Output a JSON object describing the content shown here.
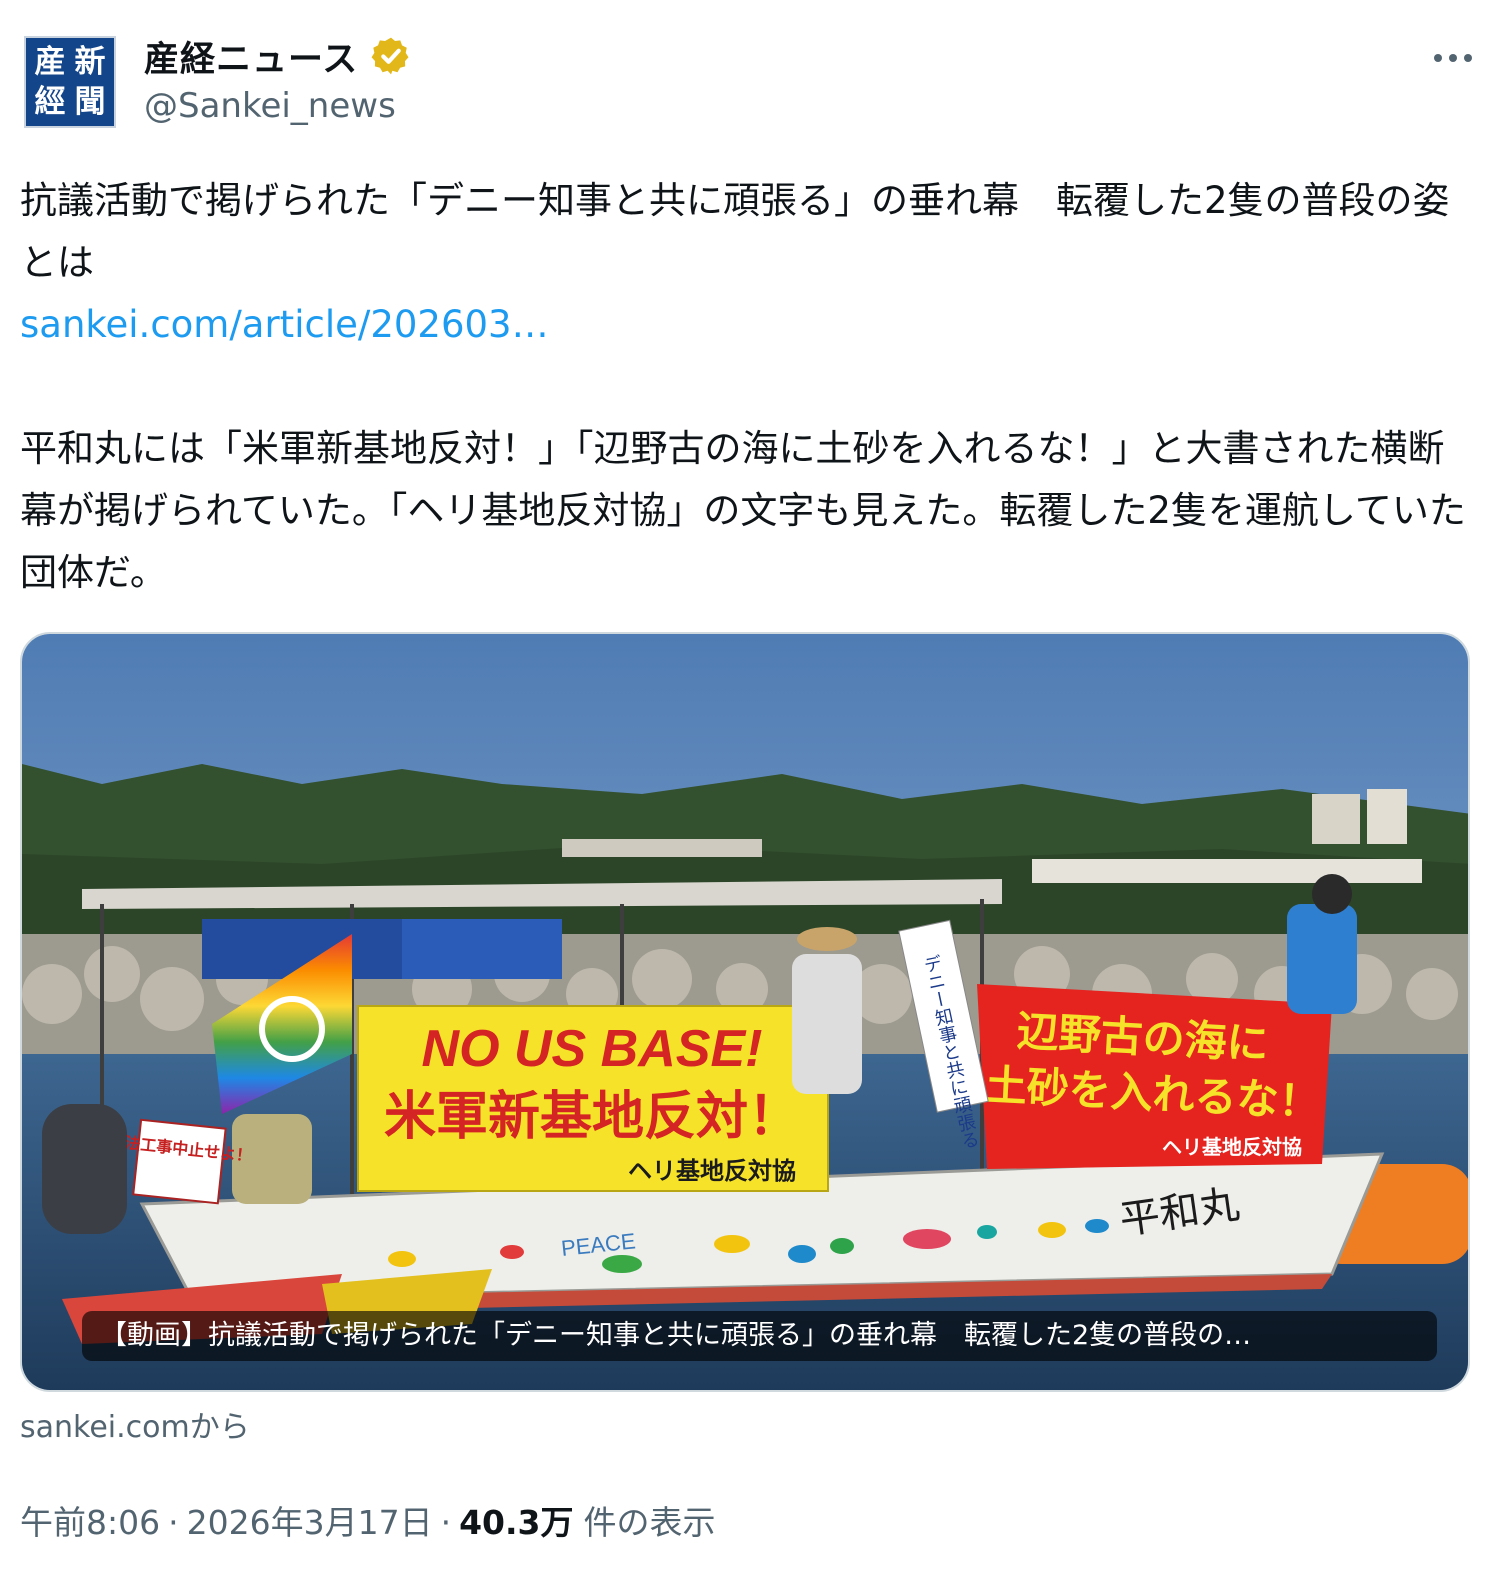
{
  "account": {
    "avatar_chars": [
      "新",
      "産",
      "聞",
      "經"
    ],
    "name": "産経ニュース",
    "handle": "@Sankei_news",
    "verified_icon": "gold-verified-badge",
    "verified_color": "#e2b719"
  },
  "more_icon": "more-horizontal-icon",
  "post": {
    "line1": "抗議活動で掲げられた「デニー知事と共に頑張る」の垂れ幕　転覆した2隻の普段の姿とは",
    "link": "sankei.com/article/202603…",
    "paragraph2": "平和丸には「米軍新基地反対！」「辺野古の海に土砂を入れるな！」と大書された横断幕が掲げられていた。「ヘリ基地反対協」の文字も見えた。転覆した2隻を運航していた団体だ。"
  },
  "media": {
    "banner_yellow_line1": "NO US BASE!",
    "banner_yellow_line2": "米軍新基地反対！",
    "banner_yellow_line3": "ヘリ基地反対協",
    "banner_red_line1": "辺野古の海に",
    "banner_red_line2": "土砂を入れるな！",
    "banner_red_line3": "ヘリ基地反対協",
    "vertical_banner": "デニー知事と共に頑張る",
    "sign_text": "違法工事中止せよ！",
    "boat_name": "平和丸",
    "boat_peace": "PEACE",
    "caption": "【動画】抗議活動で掲げられた「デニー知事と共に頑張る」の垂れ幕　転覆した2隻の普段の…"
  },
  "source": "sankei.comから",
  "meta": {
    "time": "午前8:06",
    "date": "2026年3月17日",
    "views": "40.3万",
    "views_label": "件の表示"
  },
  "colors": {
    "link": "#1d9bf0",
    "secondary_text": "#536471",
    "avatar_bg": "#13458a"
  }
}
